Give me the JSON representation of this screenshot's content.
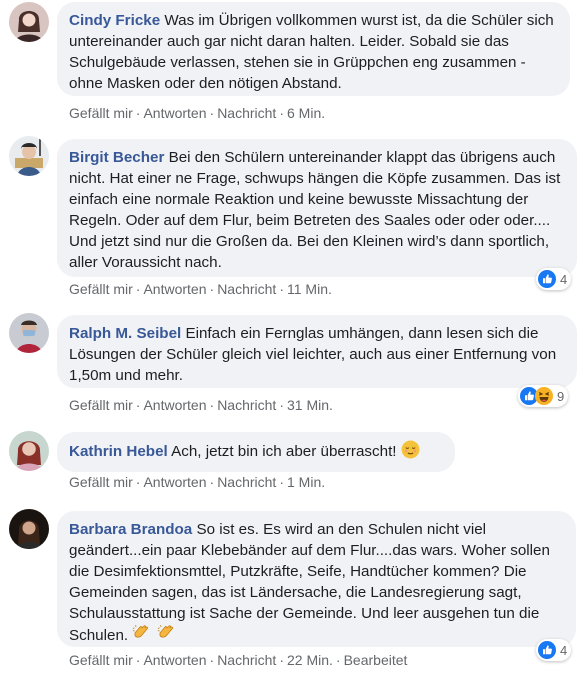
{
  "comments": [
    {
      "author": "Cindy Fricke",
      "text": " Was im Übrigen vollkommen wurst ist, da die Schüler sich untereinander auch gar nicht daran halten. Leider. Sobald sie das Schulgebäude verlassen, stehen sie in Grüppchen eng zusammen - ohne Masken oder den nötigen Abstand.",
      "time": "6 Min."
    },
    {
      "author": "Birgit Becher",
      "text": " Bei den Schülern untereinander klappt das übrigens auch nicht. Hat einer ne Frage, schwups hängen die Köpfe zusammen. Das ist einfach eine normale Reaktion und keine bewusste Missachtung der Regeln. Oder auf dem Flur, beim Betreten des Saales oder oder oder.... Und jetzt sind nur die Großen da. Bei den Kleinen wird’s dann sportlich, aller Voraussicht nach.",
      "time": "11 Min.",
      "reaction_count": "4"
    },
    {
      "author": "Ralph M. Seibel",
      "text": " Einfach ein Fernglas umhängen, dann lesen sich die Lösungen der Schüler gleich viel leichter, auch aus einer Entfernung von 1,50m und mehr.",
      "time": "31 Min.",
      "reaction_count": "9"
    },
    {
      "author": "Kathrin Hebel",
      "text": " Ach, jetzt bin ich aber überrascht!",
      "time": "1 Min."
    },
    {
      "author": "Barbara Brandoa",
      "text": " So ist es. Es wird an den Schulen nicht viel geändert...ein paar Klebebänder auf dem Flur....das wars. Woher sollen die Desimfektionsmttel, Putzkräfte, Seife, Handtücher kommen? Die Gemeinden sagen, das ist Ländersache, die Landesregierung sagt, Schulausstattung ist Sache der Gemeinde. Und leer ausgehen tun die Schulen.",
      "time": "22 Min.",
      "edited": "Bearbeitet",
      "reaction_count": "4"
    }
  ],
  "actions": {
    "like": "Gefällt mir",
    "reply": "Antworten",
    "message": "Nachricht",
    "separator": "·"
  },
  "colors": {
    "author": "#385898",
    "bubble": "#f0f2f5",
    "meta": "#65676b",
    "like_blue": "#1877f2"
  },
  "icons": {
    "like": "thumbs-up-icon",
    "haha": "laughing-emoji-icon",
    "relieved": "relieved-face-emoji-icon",
    "clap": "clapping-hands-emoji-icon"
  }
}
